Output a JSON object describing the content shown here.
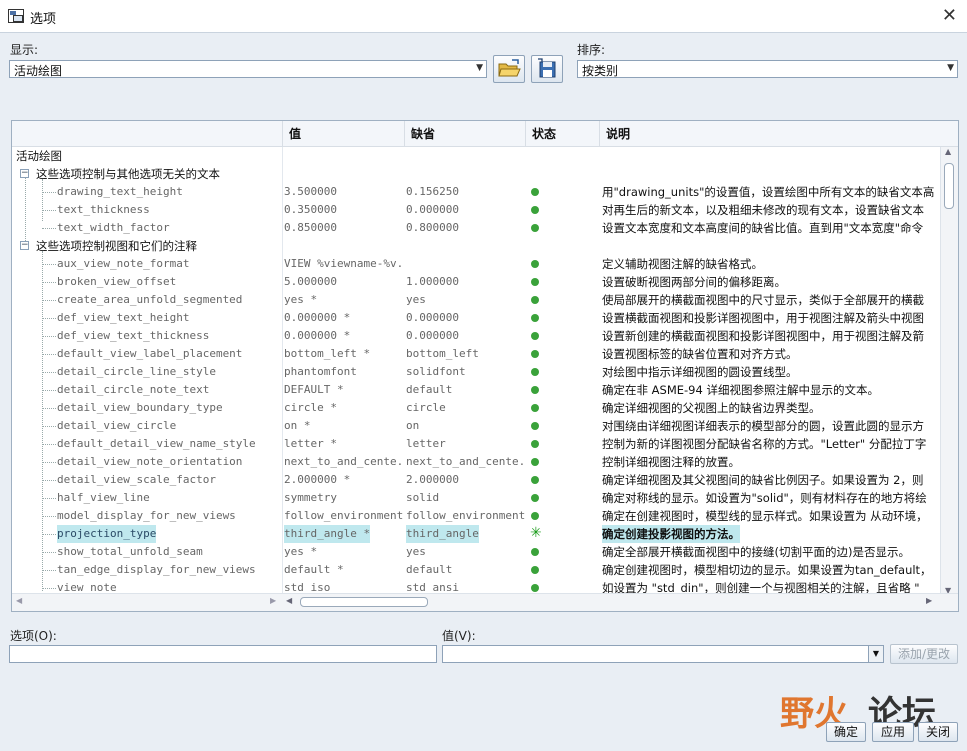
{
  "window": {
    "title": "选项"
  },
  "display": {
    "label": "显示:",
    "value": "活动绘图"
  },
  "sort": {
    "label": "排序:",
    "value": "按类别"
  },
  "columns": {
    "value": "值",
    "default": "缺省",
    "status": "状态",
    "desc": "说明"
  },
  "tree": {
    "root": "活动绘图",
    "group1": "这些选项控制与其他选项无关的文本",
    "group2": "这些选项控制视图和它们的注释"
  },
  "rows1": [
    {
      "name": "drawing_text_height",
      "value": "3.500000",
      "default": "0.156250",
      "desc": "用\"drawing_units\"的设置值，设置绘图中所有文本的缺省文本高"
    },
    {
      "name": "text_thickness",
      "value": "0.350000",
      "default": "0.000000",
      "desc": "对再生后的新文本，以及粗细未修改的现有文本，设置缺省文本"
    },
    {
      "name": "text_width_factor",
      "value": "0.850000",
      "default": "0.800000",
      "desc": "设置文本宽度和文本高度间的缺省比值。直到用\"文本宽度\"命令"
    }
  ],
  "rows2": [
    {
      "name": "aux_view_note_format",
      "value": "VIEW %viewname-%v...",
      "default": "",
      "desc": "定义辅助视图注解的缺省格式。"
    },
    {
      "name": "broken_view_offset",
      "value": "5.000000",
      "default": "1.000000",
      "desc": "设置破断视图两部分间的偏移距离。"
    },
    {
      "name": "create_area_unfold_segmented",
      "value": "yes *",
      "default": "yes",
      "desc": "使局部展开的横截面视图中的尺寸显示，类似于全部展开的横截"
    },
    {
      "name": "def_view_text_height",
      "value": "0.000000 *",
      "default": "0.000000",
      "desc": "设置横截面视图和投影详图视图中，用于视图注解及箭头中视图"
    },
    {
      "name": "def_view_text_thickness",
      "value": "0.000000 *",
      "default": "0.000000",
      "desc": "设置新创建的横截面视图和投影详图视图中，用于视图注解及箭"
    },
    {
      "name": "default_view_label_placement",
      "value": "bottom_left *",
      "default": "bottom_left",
      "desc": "设置视图标签的缺省位置和对齐方式。"
    },
    {
      "name": "detail_circle_line_style",
      "value": "phantomfont",
      "default": "solidfont",
      "desc": "对绘图中指示详细视图的圆设置线型。"
    },
    {
      "name": "detail_circle_note_text",
      "value": "DEFAULT *",
      "default": "default",
      "desc": "确定在非 ASME-94 详细视图参照注解中显示的文本。"
    },
    {
      "name": "detail_view_boundary_type",
      "value": "circle *",
      "default": "circle",
      "desc": "确定详细视图的父视图上的缺省边界类型。"
    },
    {
      "name": "detail_view_circle",
      "value": "on *",
      "default": "on",
      "desc": "对围绕由详细视图详细表示的模型部分的圆，设置此圆的显示方"
    },
    {
      "name": "default_detail_view_name_style",
      "value": "letter *",
      "default": "letter",
      "desc": "控制为新的详图视图分配缺省名称的方式。\"Letter\" 分配拉丁字"
    },
    {
      "name": "detail_view_note_orientation",
      "value": "next_to_and_cente...",
      "default": "next_to_and_cente...",
      "desc": "控制详细视图注释的放置。"
    },
    {
      "name": "detail_view_scale_factor",
      "value": "2.000000 *",
      "default": "2.000000",
      "desc": "确定详细视图及其父视图间的缺省比例因子。如果设置为 2，则"
    },
    {
      "name": "half_view_line",
      "value": "symmetry",
      "default": "solid",
      "desc": "确定对称线的显示。如设置为\"solid\"，则有材料存在的地方将绘"
    },
    {
      "name": "model_display_for_new_views",
      "value": "follow_environment *",
      "default": "follow_environment",
      "desc": "确定在创建视图时，模型线的显示样式。如果设置为 从动环境，"
    },
    {
      "name": "projection_type",
      "value": "third_angle *",
      "default": "third_angle",
      "desc": "确定创建投影视图的方法。"
    },
    {
      "name": "show_total_unfold_seam",
      "value": "yes *",
      "default": "yes",
      "desc": "确定全部展开横截面视图中的接缝(切割平面的边)是否显示。"
    },
    {
      "name": "tan_edge_display_for_new_views",
      "value": "default *",
      "default": "default",
      "desc": "确定创建视图时，模型相切边的显示。如果设置为tan_default，"
    },
    {
      "name": "view_note",
      "value": "std_iso",
      "default": "std_ansi",
      "desc": "如设置为 \"std_din\"，则创建一个与视图相关的注解，且省略 \""
    }
  ],
  "option_field": {
    "label": "选项(O):",
    "value": ""
  },
  "value_field": {
    "label": "值(V):",
    "value": ""
  },
  "buttons": {
    "add_change": "添加/更改",
    "ok": "确定",
    "apply": "应用",
    "close": "关闭"
  },
  "watermark": {
    "part1": "野火",
    "part2": "论坛"
  },
  "colors": {
    "status_ok": "#3aa23a",
    "highlight": "#bfe8ee"
  }
}
